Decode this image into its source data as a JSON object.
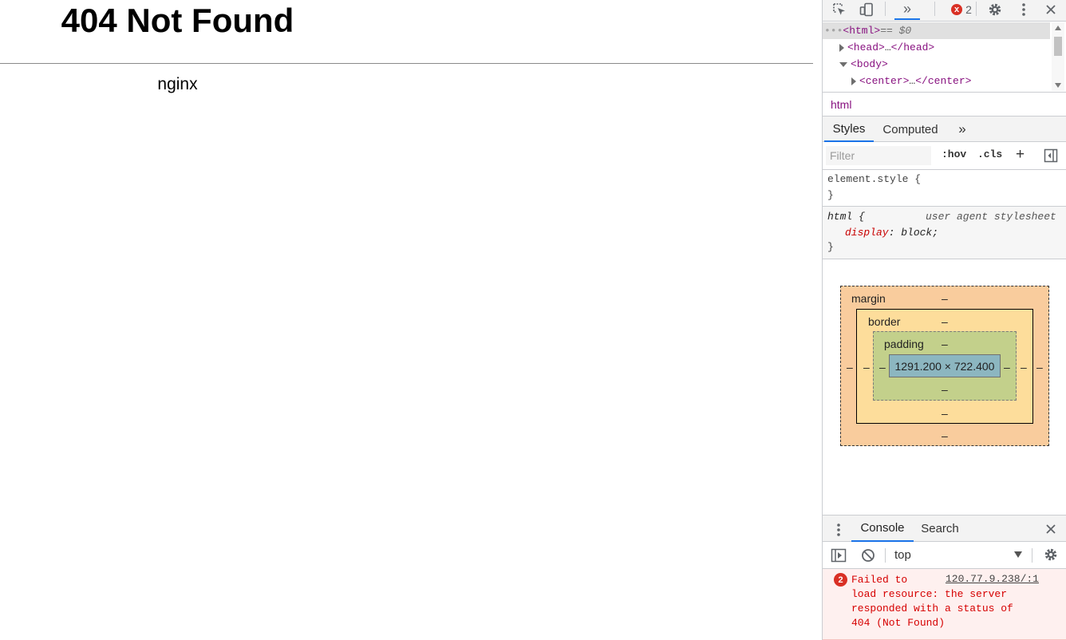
{
  "page": {
    "heading": "404 Not Found",
    "server": "nginx"
  },
  "devtools": {
    "toolbar": {
      "more_tabs_glyph": "»",
      "error_count": "2",
      "error_icon": "x"
    },
    "elements_tree": {
      "rows": [
        {
          "prefix": "•••",
          "tag_open": "<html>",
          "suffix": " == $0"
        },
        {
          "tag_open": "<head>",
          "ellipsis": "…",
          "tag_close": "</head>"
        },
        {
          "tag_open": "<body>"
        },
        {
          "tag_open": "<center>",
          "ellipsis": "…",
          "tag_close": "</center>"
        }
      ]
    },
    "breadcrumb": "html",
    "styles_tabs": {
      "styles": "Styles",
      "computed": "Computed",
      "more": "»"
    },
    "filter": {
      "placeholder": "Filter",
      "hov": ":hov",
      "cls": ".cls",
      "add": "+"
    },
    "rules": [
      {
        "selector": "element.style {",
        "close": "}"
      },
      {
        "selector": "html {",
        "source": "user agent stylesheet",
        "property": "display",
        "value": "block;",
        "close": "}"
      }
    ],
    "box_model": {
      "margin_label": "margin",
      "border_label": "border",
      "padding_label": "padding",
      "content_size": "1291.200 × 722.400",
      "dash": "–"
    },
    "drawer": {
      "tabs": [
        "Console",
        "Search"
      ],
      "context": "top"
    },
    "console_message": {
      "count": "2",
      "text": "Failed to\nload resource: the server\nresponded with a status of\n404 (Not Found)",
      "link": "120.77.9.238/:1"
    },
    "colors": {
      "accent": "#1a73e8",
      "error": "#d93025"
    }
  }
}
